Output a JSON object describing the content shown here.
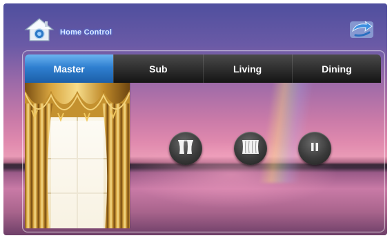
{
  "header": {
    "title": "Home Control",
    "logo_icon": "home-icon",
    "right_icon": "back-arrow-icon"
  },
  "tabs": [
    {
      "label": "Master",
      "active": true
    },
    {
      "label": "Sub",
      "active": false
    },
    {
      "label": "Living",
      "active": false
    },
    {
      "label": "Dining",
      "active": false
    }
  ],
  "controls": [
    {
      "name": "open-curtain-button",
      "icon": "curtain-open-icon"
    },
    {
      "name": "close-curtain-button",
      "icon": "curtain-closed-icon"
    },
    {
      "name": "pause-curtain-button",
      "icon": "pause-icon"
    }
  ],
  "colors": {
    "active_tab": "#2f7fd0",
    "tab_bar": "#1c1c1c",
    "title_glow": "#4a8cff",
    "curtain_gold": "#c9962c"
  }
}
